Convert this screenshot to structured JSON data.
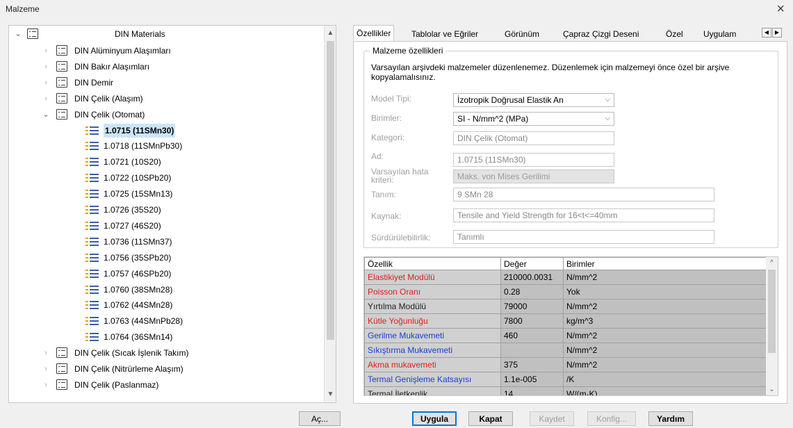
{
  "window": {
    "title": "Malzeme",
    "close": "×"
  },
  "tree": {
    "root": "DIN Materials",
    "items": [
      {
        "label": "DIN Alüminyum Alaşımları",
        "type": "folder",
        "state": "collapsed"
      },
      {
        "label": "DIN Bakır Alaşımları",
        "type": "folder",
        "state": "collapsed"
      },
      {
        "label": "DIN Demir",
        "type": "folder",
        "state": "collapsed"
      },
      {
        "label": "DIN Çelik (Alaşım)",
        "type": "folder",
        "state": "collapsed"
      },
      {
        "label": "DIN Çelik (Otomat)",
        "type": "folder",
        "state": "expanded"
      },
      {
        "label": "1.0715 (11SMn30)",
        "type": "material",
        "selected": true
      },
      {
        "label": "1.0718 (11SMnPb30)",
        "type": "material"
      },
      {
        "label": "1.0721 (10S20)",
        "type": "material"
      },
      {
        "label": "1.0722 (10SPb20)",
        "type": "material"
      },
      {
        "label": "1.0725 (15SMn13)",
        "type": "material"
      },
      {
        "label": "1.0726 (35S20)",
        "type": "material"
      },
      {
        "label": "1.0727 (46S20)",
        "type": "material"
      },
      {
        "label": "1.0736 (11SMn37)",
        "type": "material"
      },
      {
        "label": "1.0756 (35SPb20)",
        "type": "material"
      },
      {
        "label": "1.0757 (46SPb20)",
        "type": "material"
      },
      {
        "label": "1.0760 (38SMn28)",
        "type": "material"
      },
      {
        "label": "1.0762 (44SMn28)",
        "type": "material"
      },
      {
        "label": "1.0763 (44SMnPb28)",
        "type": "material"
      },
      {
        "label": "1.0764 (36SMn14)",
        "type": "material"
      },
      {
        "label": "DIN Çelik (Sıcak İşlenik Takım)",
        "type": "folder",
        "state": "collapsed"
      },
      {
        "label": "DIN Çelik (Nitrürleme Alaşım)",
        "type": "folder",
        "state": "collapsed"
      },
      {
        "label": "DIN Çelik (Paslanmaz)",
        "type": "folder",
        "state": "collapsed"
      }
    ]
  },
  "tabs": [
    {
      "label": "Özellikler",
      "active": true
    },
    {
      "label": "Tablolar ve Eğriler"
    },
    {
      "label": "Görünüm"
    },
    {
      "label": "Çapraz Çizgi Deseni"
    },
    {
      "label": "Özel"
    },
    {
      "label": "Uygulam"
    }
  ],
  "props": {
    "group_title": "Malzeme özellikleri",
    "note": "Varsayılan arşivdeki malzemeler düzenlenemez. Düzenlemek için malzemeyi önce özel bir arşive kopyalamalısınız.",
    "model_type_label": "Model Tipi:",
    "model_type_value": "İzotropik Doğrusal Elastik An",
    "units_label": "Birimler:",
    "units_value": "SI - N/mm^2 (MPa)",
    "category_label": "Kategori:",
    "category_value": "DIN Çelik (Otomat)",
    "name_label": "Ad:",
    "name_value": "1.0715 (11SMn30)",
    "failure_label": "Varsayılan hata kriteri:",
    "failure_value": "Maks. von Mises Gerilimi",
    "desc_label": "Tanım:",
    "desc_value": "9 SMn 28",
    "source_label": "Kaynak:",
    "source_value": "Tensile and Yield Strength for 16<t<=40mm",
    "sustain_label": "Sürdürülebilirlik:",
    "sustain_value": "Tanımlı"
  },
  "grid": {
    "headers": [
      "Özellik",
      "Değer",
      "Birimler"
    ],
    "rows": [
      {
        "name": "Elastikiyet Modülü",
        "value": "210000.0031",
        "unit": "N/mm^2",
        "color": "#e02020"
      },
      {
        "name": "Poisson Oranı",
        "value": "0.28",
        "unit": "Yok",
        "color": "#e02020"
      },
      {
        "name": "Yırtılma Modülü",
        "value": "79000",
        "unit": "N/mm^2",
        "color": "#202020"
      },
      {
        "name": "Kütle Yoğunluğu",
        "value": "7800",
        "unit": "kg/m^3",
        "color": "#e02020"
      },
      {
        "name": "Gerilme Mukavemeti",
        "value": "460",
        "unit": "N/mm^2",
        "color": "#1a3fd0"
      },
      {
        "name": "Sıkıştırma Mukavemeti",
        "value": "",
        "unit": "N/mm^2",
        "color": "#1a3fd0"
      },
      {
        "name": "Akma mukavemeti",
        "value": "375",
        "unit": "N/mm^2",
        "color": "#e02020"
      },
      {
        "name": "Termal Genişleme Katsayısı",
        "value": "1.1e-005",
        "unit": "/K",
        "color": "#1a3fd0"
      },
      {
        "name": "Termal İletkenlik",
        "value": "14",
        "unit": "W/(m·K)",
        "color": "#202020"
      }
    ]
  },
  "buttons": {
    "apply_to": "Aç...",
    "apply": "Uygula",
    "close": "Kapat",
    "save": "Kaydet",
    "config": "Konfig...",
    "help": "Yardım"
  }
}
